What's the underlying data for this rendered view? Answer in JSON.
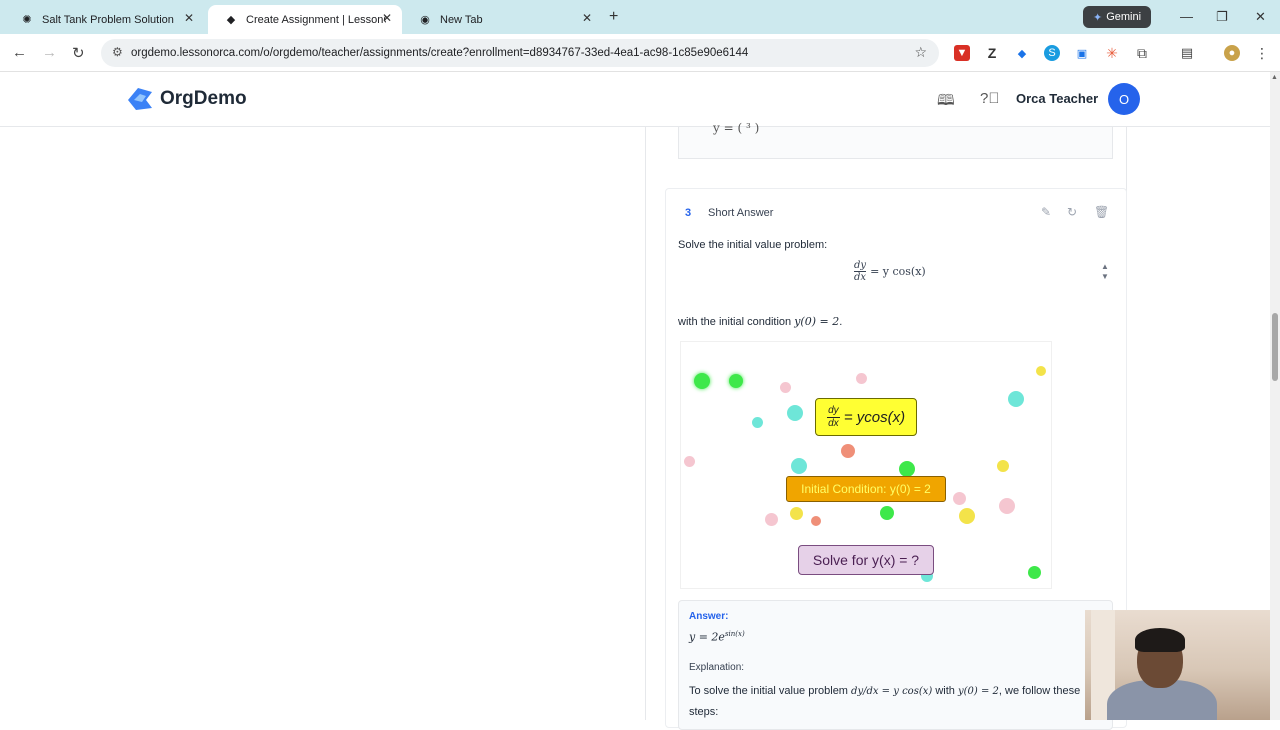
{
  "browser": {
    "tabs": [
      {
        "title": "Salt Tank Problem Solution",
        "active": false
      },
      {
        "title": "Create Assignment | LessonOrca",
        "active": true
      },
      {
        "title": "New Tab",
        "active": false
      }
    ],
    "gemini_label": "Gemini",
    "url": "orgdemo.lessonorca.com/o/orgdemo/teacher/assignments/create?enrollment=d8934767-33ed-4ea1-ac98-1c85e90e6144"
  },
  "app": {
    "brand": "OrgDemo",
    "user_name": "Orca Teacher",
    "avatar_initial": "O"
  },
  "question": {
    "number": "3",
    "type": "Short Answer",
    "prompt": "Solve the initial value problem:",
    "equation_lhs_num": "dy",
    "equation_lhs_den": "dx",
    "equation_rhs": "= y cos(x)",
    "condition_prefix": "with the initial condition",
    "condition_math": "y(0) = 2",
    "condition_suffix": ".",
    "prev_math_fragment": "y = (  ³  )"
  },
  "animation": {
    "eq_num": "dy",
    "eq_den": "dx",
    "eq_rhs": "= ycos(x)",
    "initial_condition": "Initial Condition: y(0) = 2",
    "solve_prompt": "Solve for y(x) = ?",
    "colors": {
      "equation_box": "#ffff33",
      "initial_box": "#f0a500",
      "solve_box": "#e6d1e8"
    }
  },
  "answer": {
    "label": "Answer:",
    "value_base": "y = 2e",
    "value_exp": "sin(x)",
    "explanation_label": "Explanation:",
    "explanation_intro": "To solve the initial value problem",
    "explanation_eq": "dy/dx = y cos(x)",
    "explanation_with": "with",
    "explanation_cond": "y(0) = 2",
    "explanation_tail": ", we follow these steps:"
  }
}
